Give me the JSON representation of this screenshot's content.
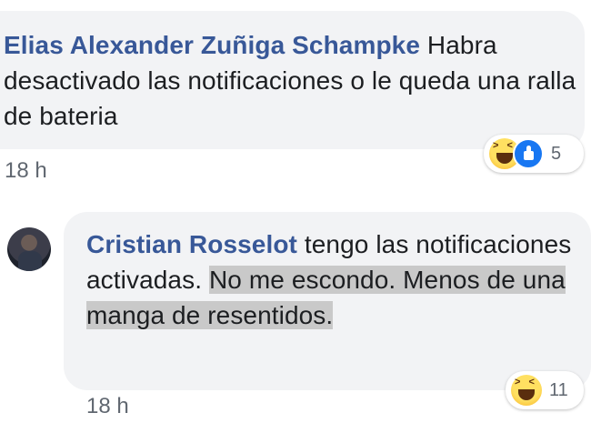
{
  "comment_1": {
    "author": "Elias Alexander Zuñiga Schampke",
    "text": "Habra desactivado las notificaciones o le queda una ralla de bateria",
    "time": "18 h",
    "reaction_count": "5",
    "reactions": [
      "haha-icon",
      "like-icon"
    ]
  },
  "comment_2": {
    "author": "Cristian Rosselot",
    "text_plain": "tengo las notificaciones activadas.",
    "text_highlighted": "No me escondo. Menos de una manga de resentidos.",
    "time": "18 h",
    "reaction_count": "11",
    "reactions": [
      "haha-icon"
    ]
  },
  "colors": {
    "author": "#385898",
    "bubble": "#f2f3f5",
    "highlight": "#c9c9c9",
    "meta": "#606770"
  }
}
